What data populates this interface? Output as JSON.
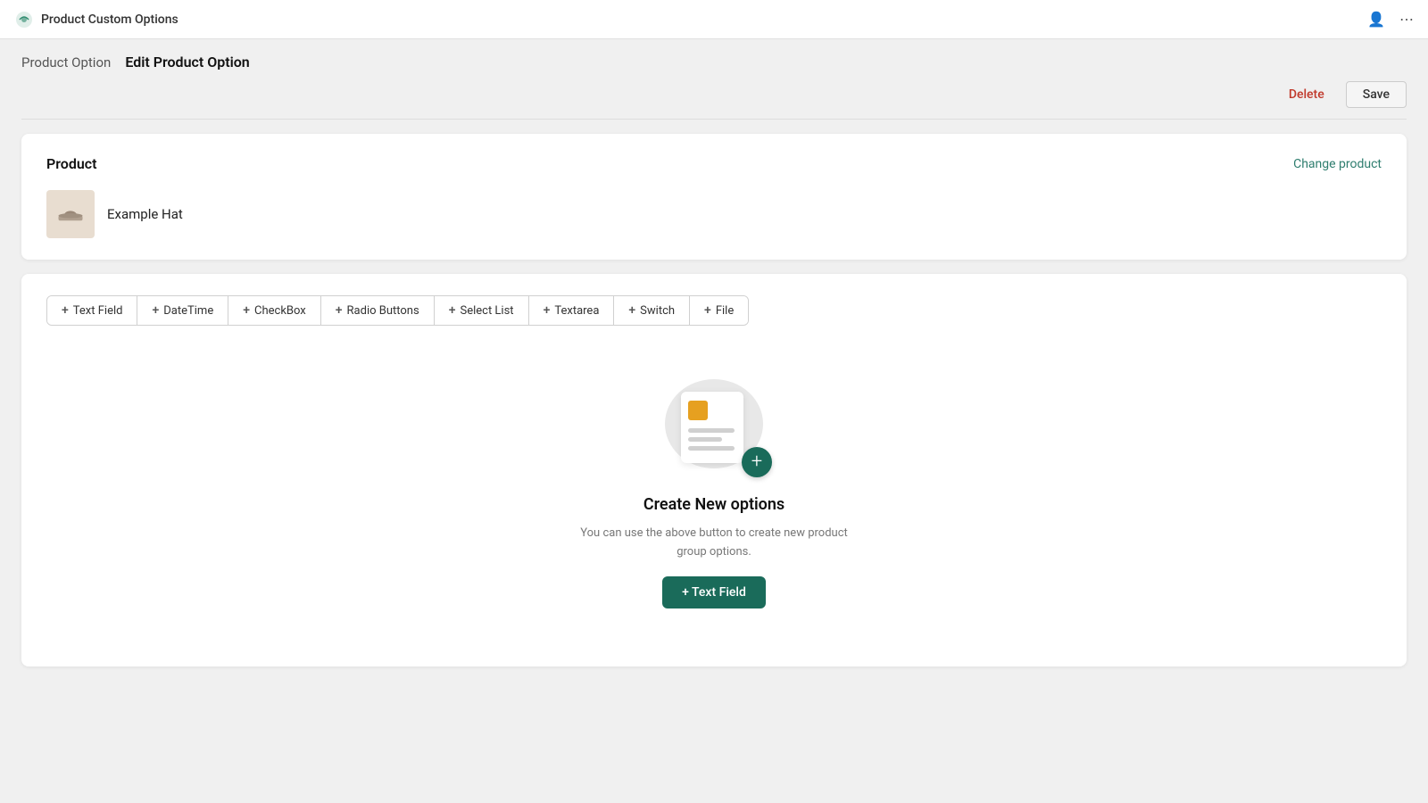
{
  "app": {
    "title": "Product Custom Options"
  },
  "header": {
    "breadcrumb_parent": "Product Option",
    "breadcrumb_current": "Edit Product Option",
    "delete_label": "Delete",
    "save_label": "Save"
  },
  "product_card": {
    "section_title": "Product",
    "change_link": "Change product",
    "product_name": "Example Hat"
  },
  "options_card": {
    "tabs": [
      {
        "label": "Text Field"
      },
      {
        "label": "DateTime"
      },
      {
        "label": "CheckBox"
      },
      {
        "label": "Radio Buttons"
      },
      {
        "label": "Select List"
      },
      {
        "label": "Textarea"
      },
      {
        "label": "Switch"
      },
      {
        "label": "File"
      }
    ],
    "empty_state": {
      "title": "Create New options",
      "description": "You can use the above button to create new product group options.",
      "add_button": "+ Text Field"
    }
  },
  "icons": {
    "user": "👤",
    "more": "⋯"
  }
}
